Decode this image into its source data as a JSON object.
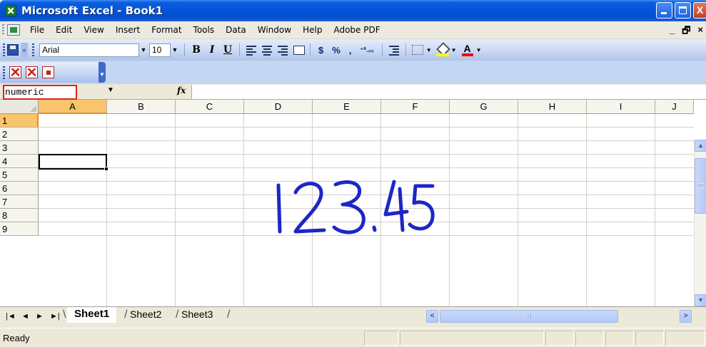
{
  "window": {
    "title": "Microsoft Excel - Book1",
    "buttons": {
      "minimize": "_",
      "maximize": "□",
      "close": "X"
    }
  },
  "menu": {
    "items": [
      "File",
      "Edit",
      "View",
      "Insert",
      "Format",
      "Tools",
      "Data",
      "Window",
      "Help",
      "Adobe PDF"
    ],
    "right": {
      "minimize": "_",
      "restore": "🗗",
      "close": "×"
    }
  },
  "toolbar": {
    "font": "Arial",
    "size": "10",
    "bold": "B",
    "italic": "I",
    "underline": "U",
    "currency": "$",
    "percent": "%",
    "comma": ",",
    "increase_decimal": "⁺⁰.₀₀",
    "font_color_glyph": "A"
  },
  "formula_bar": {
    "name_box": "numeric",
    "fx": "fx",
    "value": ""
  },
  "grid": {
    "columns": [
      "A",
      "B",
      "C",
      "D",
      "E",
      "F",
      "G",
      "H",
      "I",
      "J"
    ],
    "rows": [
      "1",
      "2",
      "3",
      "4",
      "5",
      "6",
      "7",
      "8",
      "9"
    ],
    "active_cell": "A1",
    "handwritten_value": "123.45",
    "ink_color": "#1e26c7"
  },
  "sheets": {
    "tabs": [
      "Sheet1",
      "Sheet2",
      "Sheet3"
    ],
    "active": "Sheet1",
    "nav": [
      "|◄",
      "◄",
      "►",
      "►|"
    ]
  },
  "status": {
    "text": "Ready"
  }
}
